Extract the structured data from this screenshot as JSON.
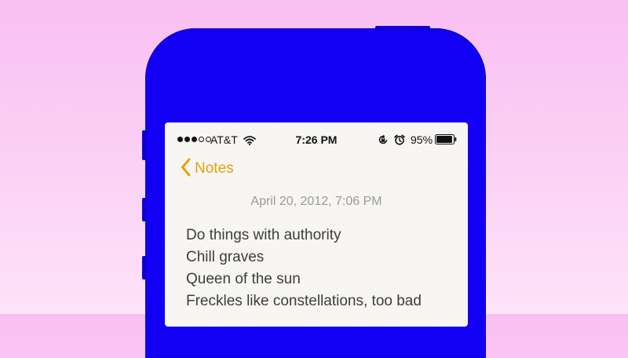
{
  "status_bar": {
    "carrier": "AT&T",
    "time": "7:26 PM",
    "battery_percent": "95%",
    "signal_strength": 3,
    "signal_max": 5,
    "battery_level": 0.95,
    "icons": [
      "wifi-icon",
      "orientation-lock-icon",
      "alarm-icon",
      "battery-icon"
    ]
  },
  "nav": {
    "back_label": "Notes"
  },
  "note": {
    "date": "April 20, 2012, 7:06 PM",
    "lines": [
      "Do things with authority",
      "Chill graves",
      "Queen of the sun",
      "Freckles like constellations, too bad"
    ]
  },
  "colors": {
    "background": "#f9bff2",
    "phone_body": "#1200f4",
    "accent": "#e2a30b",
    "paper": "#f8f7f5"
  }
}
